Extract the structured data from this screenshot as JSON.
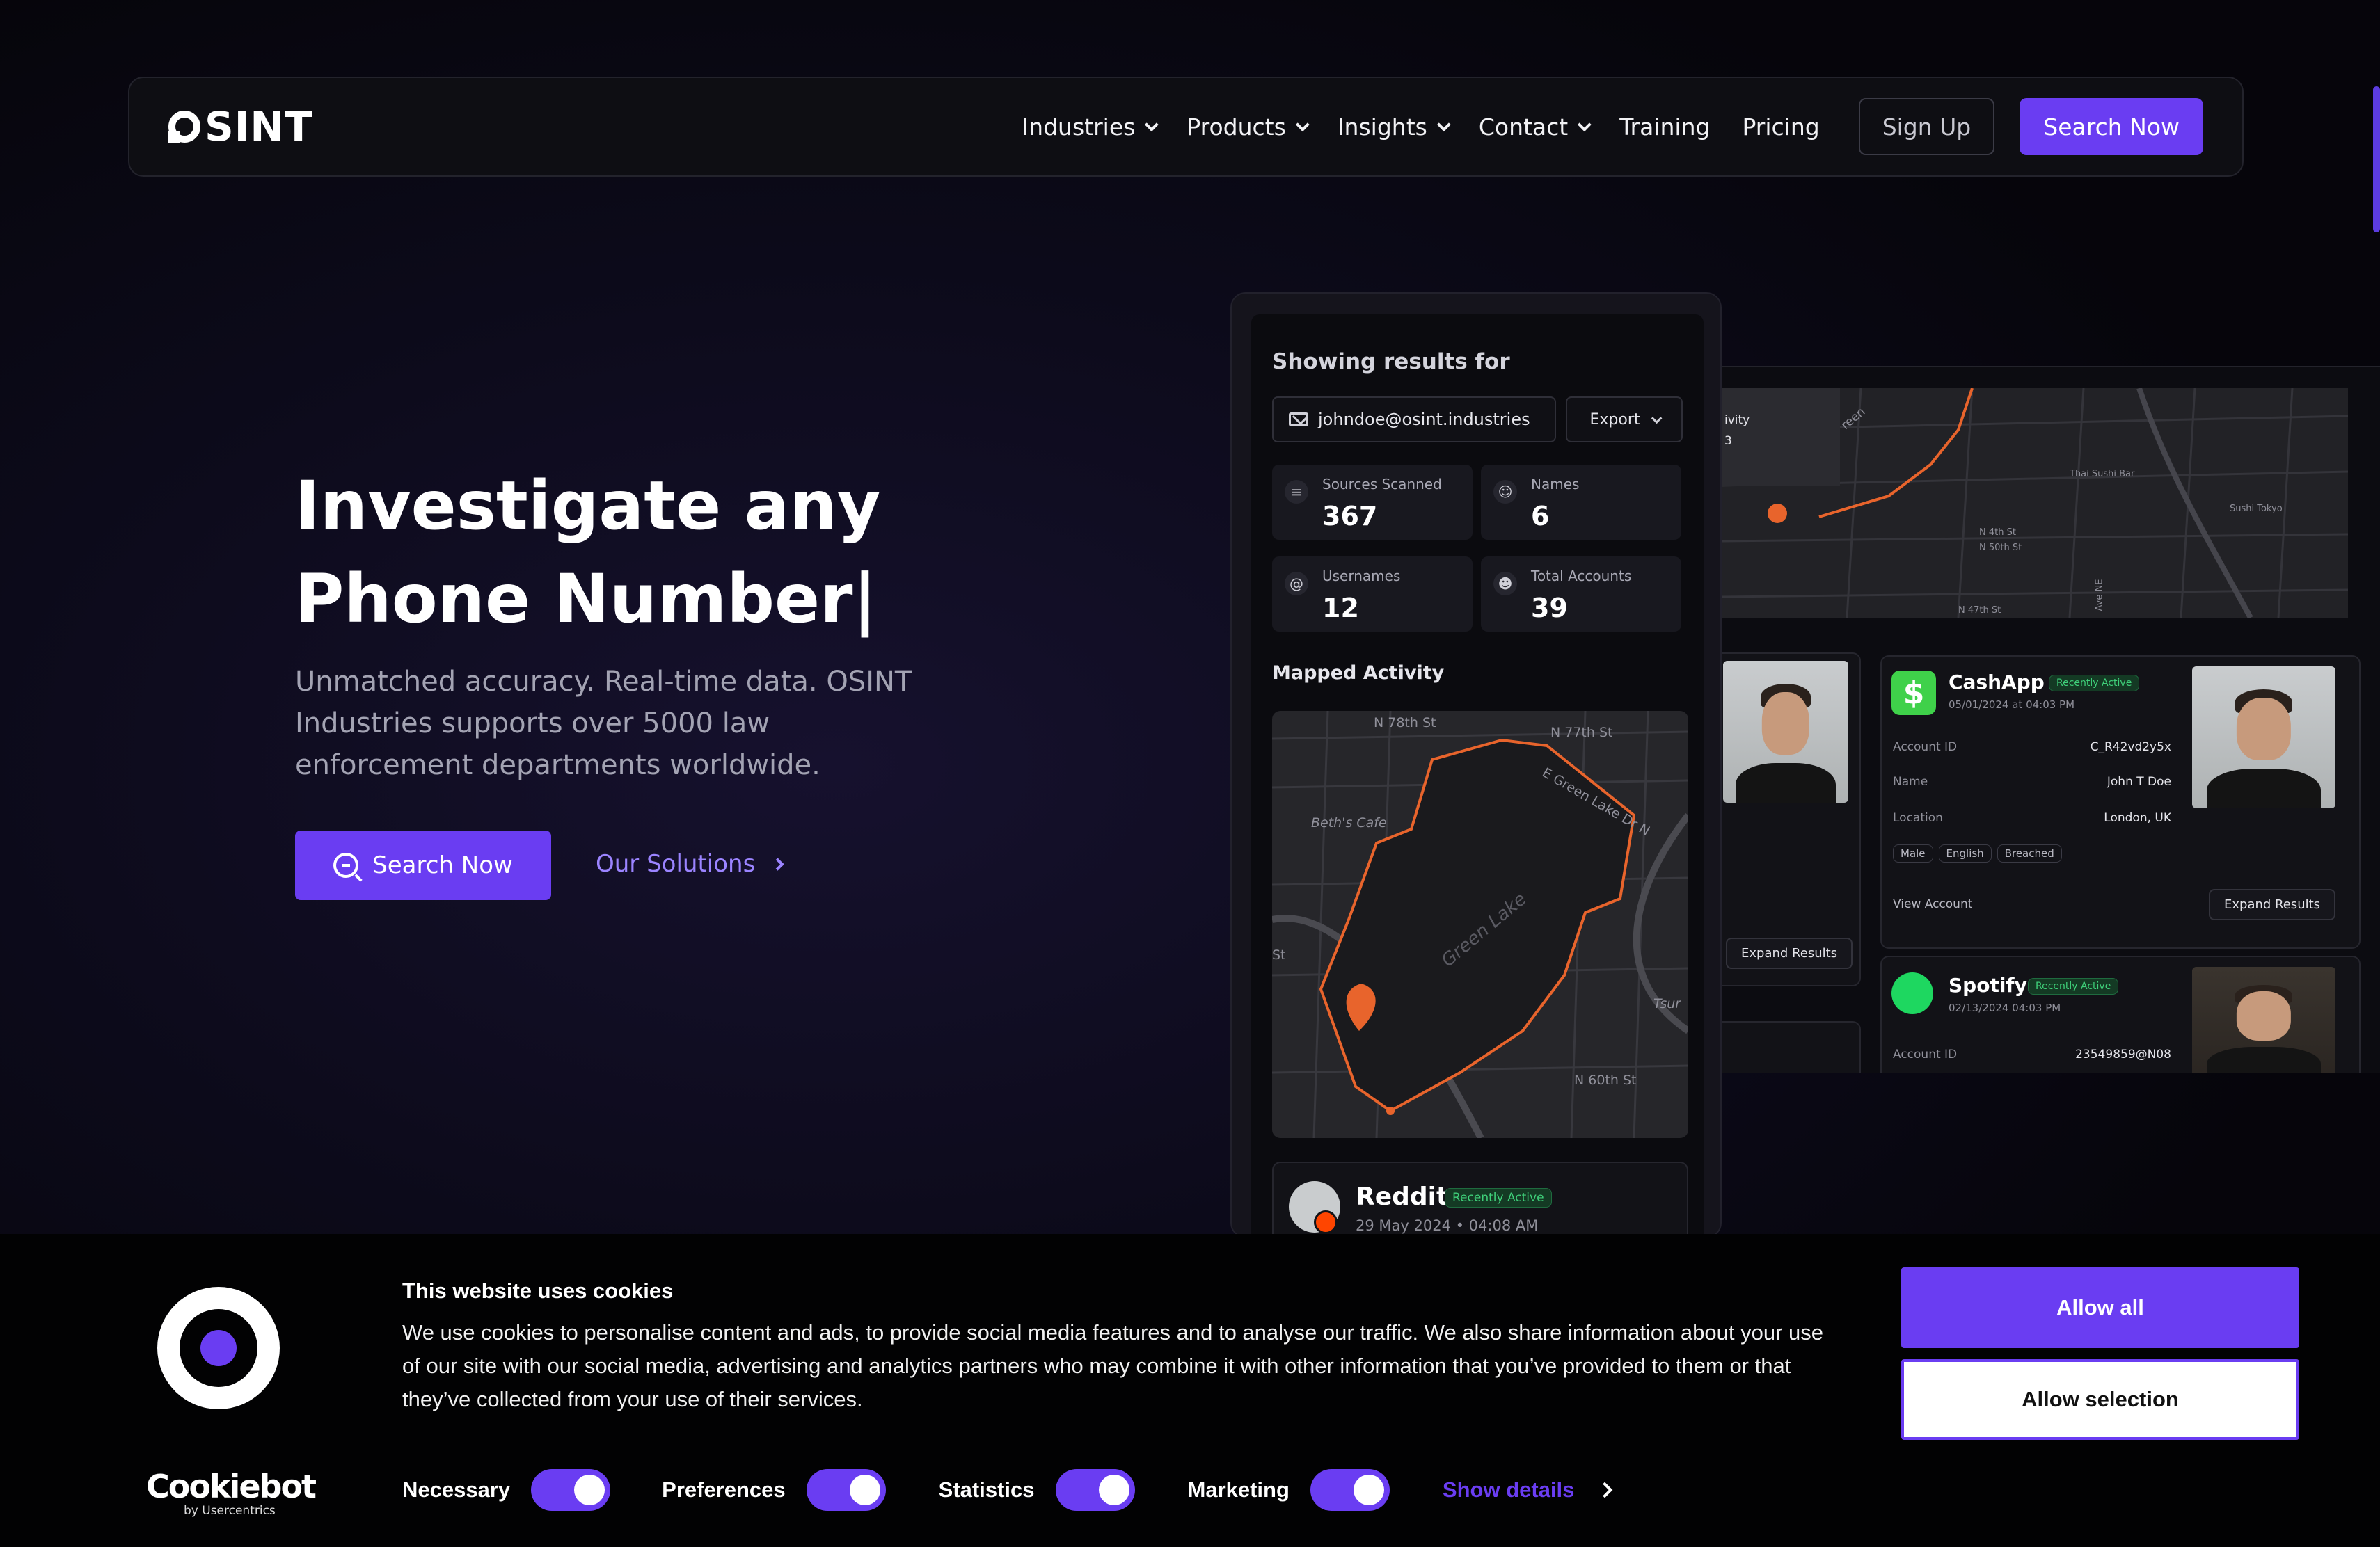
{
  "nav": {
    "logo": "SINT",
    "items": [
      {
        "label": "Industries",
        "dropdown": true
      },
      {
        "label": "Products",
        "dropdown": true
      },
      {
        "label": "Insights",
        "dropdown": true
      },
      {
        "label": "Contact",
        "dropdown": true
      },
      {
        "label": "Training",
        "dropdown": false
      },
      {
        "label": "Pricing",
        "dropdown": false
      }
    ],
    "signup": "Sign Up",
    "search": "Search Now"
  },
  "hero": {
    "title_line1": "Investigate any",
    "title_line2": "Phone Number|",
    "subtitle": "Unmatched accuracy. Real-time data. OSINT Industries supports over 5000 law enforcement departments worldwide.",
    "cta_primary": "Search Now",
    "cta_secondary": "Our Solutions"
  },
  "results": {
    "showing_label": "Showing results for",
    "query": "johndoe@osint.industries",
    "export": "Export",
    "stats": [
      {
        "label": "Sources Scanned",
        "value": "367",
        "icon": "database-icon"
      },
      {
        "label": "Names",
        "value": "6",
        "icon": "user-search-icon"
      },
      {
        "label": "Usernames",
        "value": "12",
        "icon": "at-icon"
      },
      {
        "label": "Total Accounts",
        "value": "39",
        "icon": "users-icon"
      }
    ],
    "mapped_activity": "Mapped Activity",
    "map_labels": [
      "N 78th St",
      "N 77th St",
      "E Green Lake Dr N",
      "Beth's Cafe",
      "Green Lake",
      "Tsur",
      "N 60th St",
      "St"
    ],
    "reddit": {
      "name": "Reddit",
      "badge": "Recently Active",
      "date": "29 May 2024 • 04:08 AM"
    }
  },
  "back_panel": {
    "map_labels": [
      "ivity",
      "3",
      "reen",
      "Thai Sushi Bar",
      "Sushi Tokyo",
      "N 4th St",
      "N 50th St",
      "N 47th St",
      "Ave NE"
    ],
    "cashapp": {
      "name": "CashApp",
      "badge": "Recently Active",
      "date": "05/01/2024 at 04:03 PM",
      "rows": [
        {
          "k": "Account ID",
          "v": "C_R42vd2y5x"
        },
        {
          "k": "Name",
          "v": "John T Doe"
        },
        {
          "k": "Location",
          "v": "London, UK"
        }
      ],
      "pills": [
        "Male",
        "English",
        "Breached"
      ],
      "view": "View Account",
      "expand": "Expand Results"
    },
    "left_expand": "Expand Results",
    "spotify": {
      "name": "Spotify",
      "badge": "Recently Active",
      "date": "02/13/2024 04:03 PM",
      "rows": [
        {
          "k": "Account ID",
          "v": "23549859@N08"
        }
      ]
    }
  },
  "cookie": {
    "title": "This website uses cookies",
    "text": "We use cookies to personalise content and ads, to provide social media features and to analyse our traffic. We also share information about your use of our site with our social media, advertising and analytics partners who may combine it with other information that you’ve provided to them or that they’ve collected from your use of their services.",
    "toggles": [
      {
        "label": "Necessary",
        "on": true
      },
      {
        "label": "Preferences",
        "on": true
      },
      {
        "label": "Statistics",
        "on": true
      },
      {
        "label": "Marketing",
        "on": true
      }
    ],
    "show_details": "Show details",
    "allow_all": "Allow all",
    "allow_selection": "Allow selection",
    "brand": "Cookiebot",
    "brand_by": "by Usercentrics",
    "accent": "#6a3df2"
  }
}
